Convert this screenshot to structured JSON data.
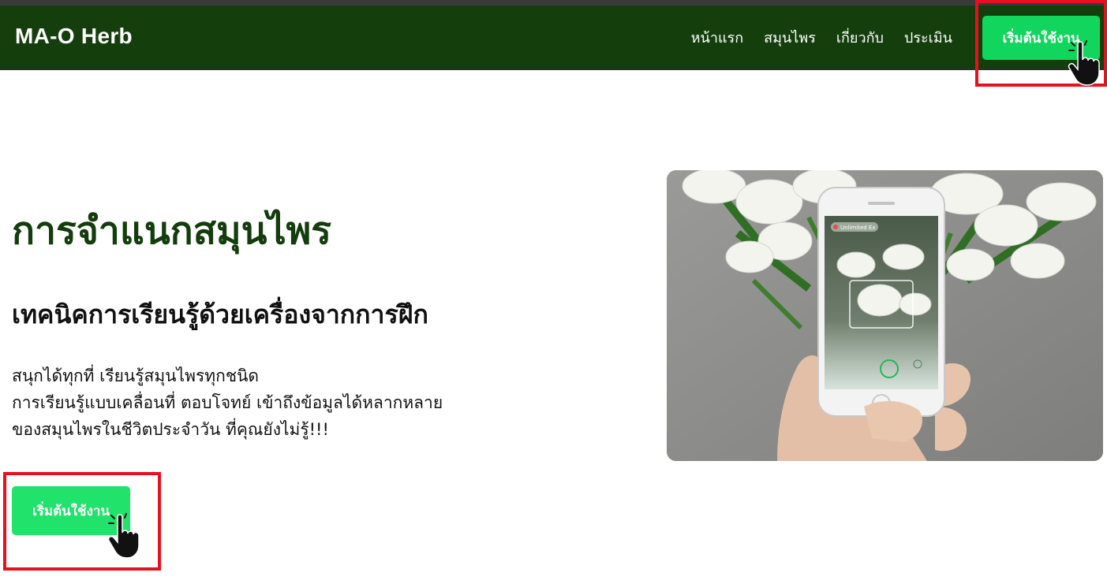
{
  "navbar": {
    "brand": "MA-O Herb",
    "links": [
      {
        "label": "หน้าแรก"
      },
      {
        "label": "สมุนไพร"
      },
      {
        "label": "เกี่ยวกับ"
      },
      {
        "label": "ประเมิน"
      }
    ],
    "cta_label": "เริ่มต้นใช้งาน"
  },
  "hero": {
    "title": "การจำแนกสมุนไพร",
    "subtitle": "เทคนิคการเรียนรู้ด้วยเครื่องจากการฝึก",
    "description_lines": [
      "สนุกได้ทุกที่ เรียนรู้สมุนไพรทุกชนิด",
      "การเรียนรู้แบบเคลื่อนที่ ตอบโจทย์ เข้าถึงข้อมูลได้หลากหลาย",
      "ของสมุนไพรในชีวิตประจำวัน ที่คุณยังไม่รู้!!!"
    ],
    "cta_label": "เริ่มต้นใช้งาน"
  },
  "image": {
    "phone_banner": "Unlimited Ex"
  },
  "colors": {
    "navbar_bg": "#143f0d",
    "title_green": "#133d0c",
    "button_green": "#21e26a",
    "highlight_red": "#e8101e"
  },
  "icons": [
    "hand-pointer-icon"
  ]
}
